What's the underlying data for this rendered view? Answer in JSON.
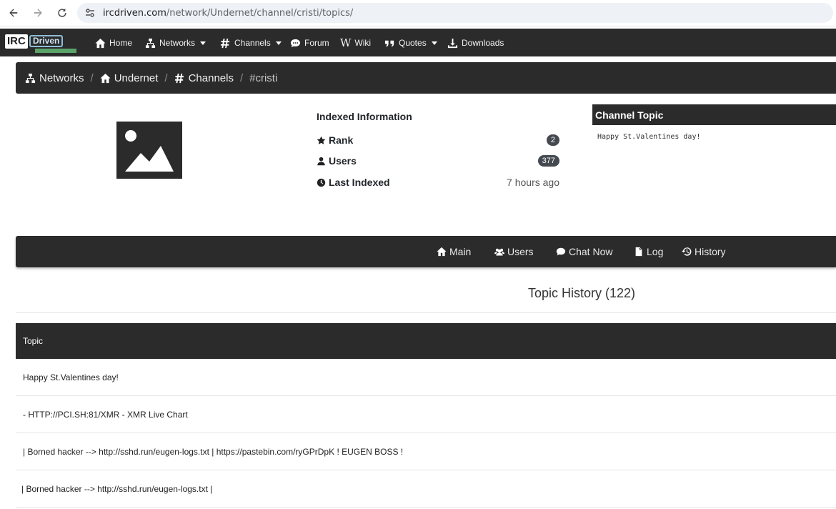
{
  "browser": {
    "url_host": "ircdriven.com",
    "url_path": "/network/Undernet/channel/cristi/topics/"
  },
  "logo": {
    "part1": "IRC",
    "part2": "Driven"
  },
  "nav": {
    "home": "Home",
    "networks": "Networks",
    "channels": "Channels",
    "forum": "Forum",
    "wiki": "Wiki",
    "quotes": "Quotes",
    "downloads": "Downloads"
  },
  "breadcrumb": {
    "networks": "Networks",
    "network": "Undernet",
    "channels": "Channels",
    "channel": "#cristi",
    "separator": "/"
  },
  "info": {
    "title": "Indexed Information",
    "rank_label": "Rank",
    "rank_value": "2",
    "users_label": "Users",
    "users_value": "377",
    "indexed_label": "Last Indexed",
    "indexed_value": "7 hours ago"
  },
  "channel_topic": {
    "title": "Channel Topic",
    "text": "Happy St.Valentines day!"
  },
  "tabs": {
    "main": "Main",
    "users": "Users",
    "chat": "Chat Now",
    "log": "Log",
    "history": "History"
  },
  "history": {
    "title": "Topic History (122)",
    "column": "Topic",
    "rows": [
      "Happy St.Valentines day!",
      "- HTTP://PCI.SH:81/XMR - XMR Live Chart",
      " | Borned hacker --> http://sshd.run/eugen-logs.txt | https://pastebin.com/ryGPrDpK ! EUGEN BOSS !",
      "| Borned hacker --> http://sshd.run/eugen-logs.txt |"
    ]
  },
  "colors": {
    "dark": "#2b2b2b",
    "badge": "#444a50"
  }
}
